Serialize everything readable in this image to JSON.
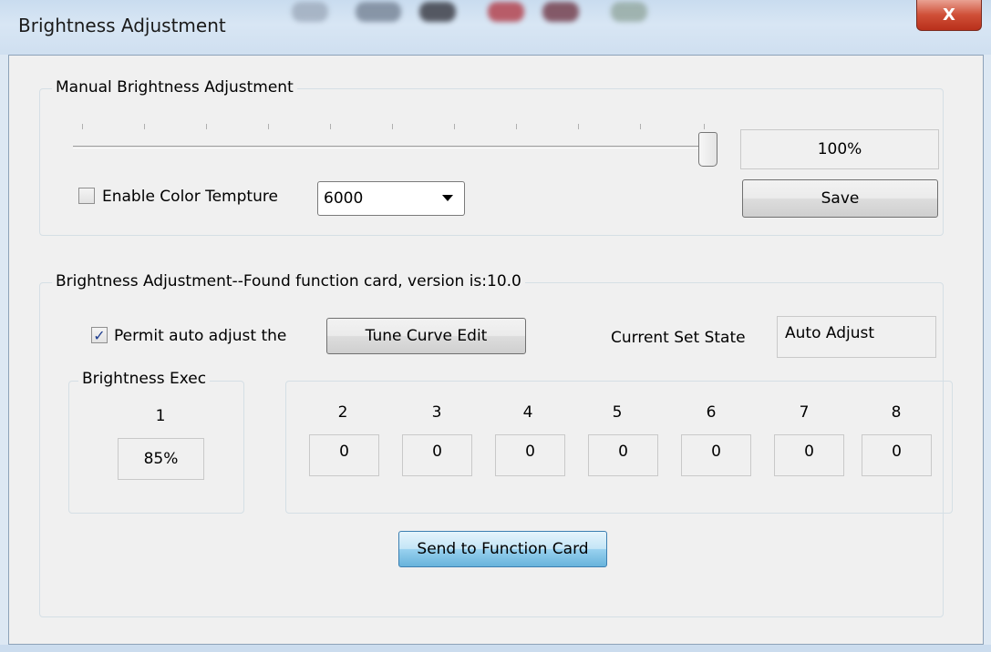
{
  "window": {
    "title": "Brightness Adjustment",
    "close_label": "X"
  },
  "manual": {
    "group_label": "Manual Brightness Adjustment",
    "slider_value": 100,
    "percent_display": "100%",
    "enable_color_label": "Enable Color Tempture",
    "enable_color_checked": false,
    "color_temp_value": "6000",
    "save_label": "Save"
  },
  "auto": {
    "group_label": "Brightness Adjustment--Found function card, version is:10.0",
    "permit_label": "Permit auto adjust the",
    "permit_checked": true,
    "tune_curve_label": "Tune Curve Edit",
    "current_state_label": "Current Set State",
    "current_state_value": "Auto Adjust",
    "exec_group_label": "Brightness Exec",
    "channels": [
      {
        "num": "1",
        "value": "85%"
      },
      {
        "num": "2",
        "value": "0"
      },
      {
        "num": "3",
        "value": "0"
      },
      {
        "num": "4",
        "value": "0"
      },
      {
        "num": "5",
        "value": "0"
      },
      {
        "num": "6",
        "value": "0"
      },
      {
        "num": "7",
        "value": "0"
      },
      {
        "num": "8",
        "value": "0"
      }
    ],
    "send_label": "Send to Function Card"
  },
  "colors": {
    "focus_button": "#98d1ef",
    "close_button": "#cf4f37",
    "check_mark": "#1d3d8f"
  },
  "icons": [
    "close-icon",
    "checkbox-icon",
    "dropdown-arrow-icon",
    "check-icon"
  ]
}
